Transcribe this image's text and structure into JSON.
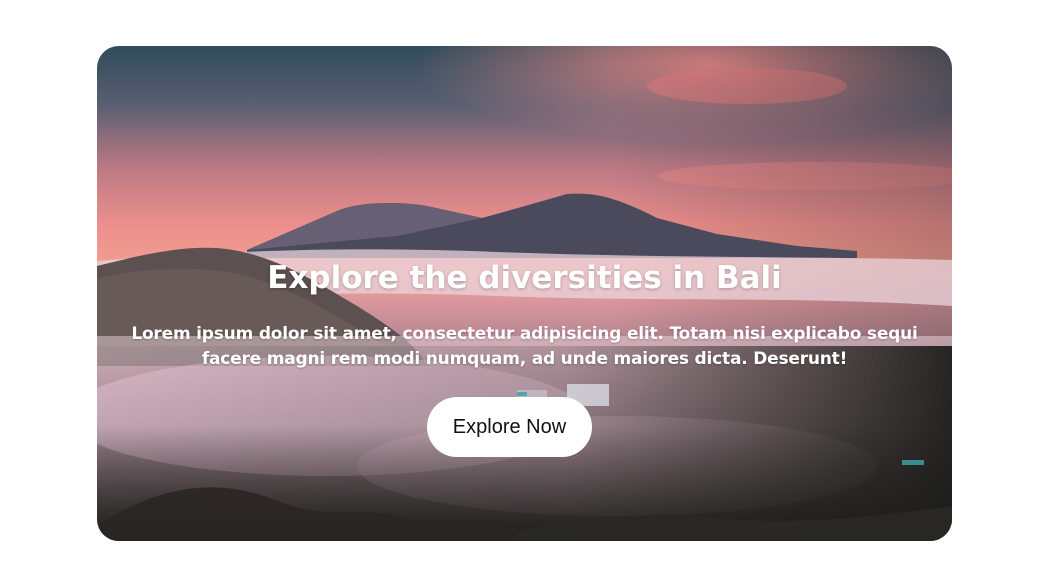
{
  "hero": {
    "title": "Explore the diversities in Bali",
    "description": "Lorem ipsum dolor sit amet, consectetur adipisicing elit. Totam nisi explicabo sequi facere magni rem modi numquam, ad unde maiores dicta. Deserunt!",
    "button_label": "Explore Now"
  },
  "colors": {
    "page_background": "#ffffff",
    "text": "#ffffff",
    "button_background": "#ffffff",
    "button_text": "#111111"
  }
}
